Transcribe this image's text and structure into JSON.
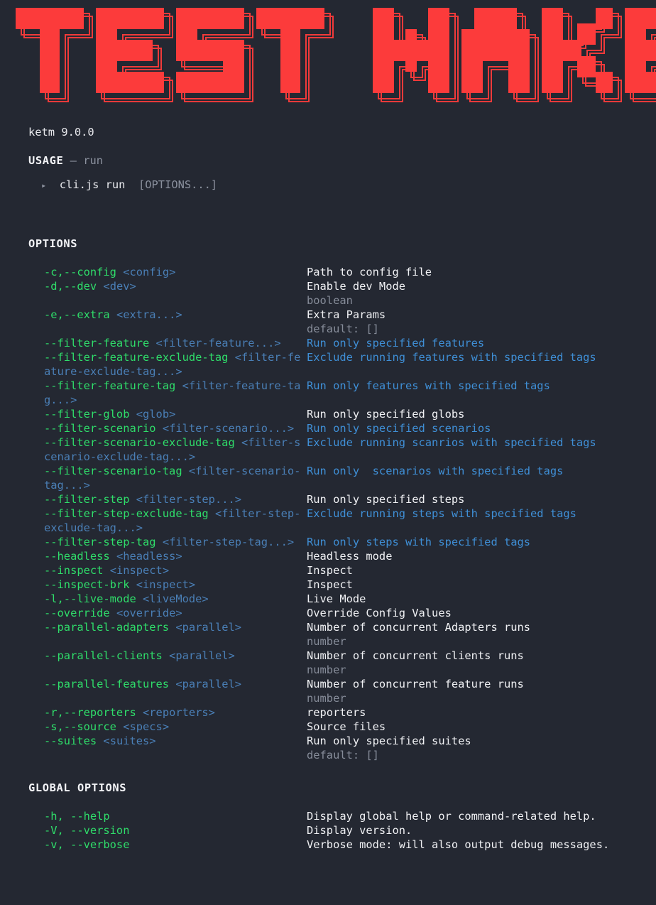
{
  "banner": {
    "text": "TEST MAKER",
    "style": "figlet-block-shadow",
    "color": "#fc3b3b",
    "outline_color": "#fc3b3b"
  },
  "background_color": "#242832",
  "version_line": "ketm 9.0.0",
  "usage": {
    "label": "USAGE",
    "dash": "—",
    "command": "run",
    "bullet": "▸",
    "example_command": "cli.js run",
    "example_args": "[OPTIONS...]"
  },
  "options_section": {
    "title": "OPTIONS",
    "items": [
      {
        "flag": "-c,--config",
        "placeholder": "<config>",
        "desc": "Path to config file",
        "desc_color": "white",
        "meta": null,
        "gap_before": 0
      },
      {
        "flag": "-d,--dev",
        "placeholder": "<dev>",
        "desc": "Enable dev Mode",
        "desc_color": "white",
        "meta": "boolean",
        "gap_before": 0
      },
      {
        "flag": "-e,--extra",
        "placeholder": "<extra...>",
        "desc": "Extra Params",
        "desc_color": "white",
        "meta": "default: []",
        "gap_before": 0
      },
      {
        "flag": "--filter-feature",
        "placeholder": "<filter-feature...>",
        "desc": "Run only specified features",
        "desc_color": "blue",
        "meta": null,
        "gap_before": 0
      },
      {
        "flag": "--filter-feature-exclude-tag",
        "placeholder": "<filter-feature-exclude-tag...>",
        "desc": "Exclude running features with specified tags",
        "desc_color": "blue",
        "meta": null,
        "gap_before": 0
      },
      {
        "flag": "--filter-feature-tag",
        "placeholder": "<filter-feature-tag...>",
        "desc": "Run only features with specified tags",
        "desc_color": "blue",
        "meta": null,
        "gap_before": 0
      },
      {
        "flag": "--filter-glob",
        "placeholder": "<glob>",
        "desc": "Run only specified globs",
        "desc_color": "white",
        "meta": null,
        "gap_before": 0
      },
      {
        "flag": "--filter-scenario",
        "placeholder": "<filter-scenario...>",
        "desc": "Run only specified scenarios",
        "desc_color": "blue",
        "meta": null,
        "gap_before": 0
      },
      {
        "flag": "--filter-scenario-exclude-tag",
        "placeholder": "<filter-scenario-exclude-tag...>",
        "desc": "Exclude running scanrios with specified tags",
        "desc_color": "blue",
        "meta": null,
        "gap_before": 0
      },
      {
        "flag": "--filter-scenario-tag",
        "placeholder": "<filter-scenario-tag...>",
        "desc": "Run only  scenarios with specified tags",
        "desc_color": "blue",
        "meta": null,
        "gap_before": 0
      },
      {
        "flag": "--filter-step",
        "placeholder": "<filter-step...>",
        "desc": "Run only specified steps",
        "desc_color": "white",
        "meta": null,
        "gap_before": 0
      },
      {
        "flag": "--filter-step-exclude-tag",
        "placeholder": "<filter-step-exclude-tag...>",
        "desc": "Exclude running steps with specified tags",
        "desc_color": "blue",
        "meta": null,
        "gap_before": 0
      },
      {
        "flag": "--filter-step-tag",
        "placeholder": "<filter-step-tag...>",
        "desc": "Run only steps with specified tags",
        "desc_color": "blue",
        "meta": null,
        "gap_before": 0
      },
      {
        "flag": "--headless",
        "placeholder": "<headless>",
        "desc": "Headless mode",
        "desc_color": "white",
        "meta": null,
        "gap_before": 0
      },
      {
        "flag": "--inspect",
        "placeholder": "<inspect>",
        "desc": "Inspect",
        "desc_color": "white",
        "meta": null,
        "gap_before": 0
      },
      {
        "flag": "--inspect-brk",
        "placeholder": "<inspect>",
        "desc": "Inspect",
        "desc_color": "white",
        "meta": null,
        "gap_before": 0
      },
      {
        "flag": "-l,--live-mode",
        "placeholder": "<liveMode>",
        "desc": "Live Mode",
        "desc_color": "white",
        "meta": null,
        "gap_before": 0
      },
      {
        "flag": "--override",
        "placeholder": "<override>",
        "desc": "Override Config Values",
        "desc_color": "white",
        "meta": null,
        "gap_before": 0
      },
      {
        "flag": "--parallel-adapters",
        "placeholder": "<parallel>",
        "desc": "Number of concurrent Adapters runs",
        "desc_color": "white",
        "meta": "number",
        "gap_before": 0
      },
      {
        "flag": "--parallel-clients",
        "placeholder": "<parallel>",
        "desc": "Number of concurrent clients runs",
        "desc_color": "white",
        "meta": "number",
        "gap_before": 0
      },
      {
        "flag": "--parallel-features",
        "placeholder": "<parallel>",
        "desc": "Number of concurrent feature runs",
        "desc_color": "white",
        "meta": "number",
        "gap_before": 0
      },
      {
        "flag": "-r,--reporters",
        "placeholder": "<reporters>",
        "desc": "reporters",
        "desc_color": "white",
        "meta": null,
        "gap_before": 0
      },
      {
        "flag": "-s,--source",
        "placeholder": "<specs>",
        "desc": "Source files",
        "desc_color": "white",
        "meta": null,
        "gap_before": 0
      },
      {
        "flag": "--suites",
        "placeholder": "<suites>",
        "desc": "Run only specified suites",
        "desc_color": "white",
        "meta": "default: []",
        "gap_before": 0
      }
    ]
  },
  "global_options_section": {
    "title": "GLOBAL OPTIONS",
    "items": [
      {
        "flag": "-h, --help",
        "desc": "Display global help or command-related help."
      },
      {
        "flag": "-V, --version",
        "desc": "Display version."
      },
      {
        "flag": "-v, --verbose",
        "desc": "Verbose mode: will also output debug messages."
      }
    ]
  }
}
